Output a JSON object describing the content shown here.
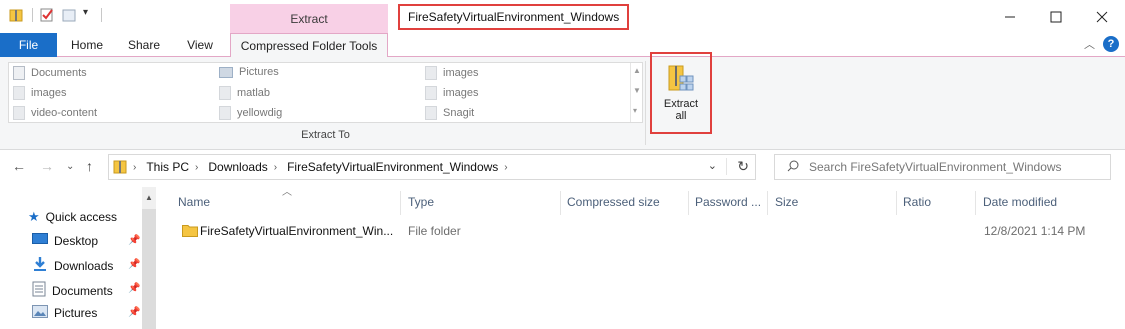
{
  "window": {
    "title": "FireSafetyVirtualEnvironment_Windows",
    "context_header": "Extract"
  },
  "tabs": {
    "file": "File",
    "home": "Home",
    "share": "Share",
    "view": "View",
    "compressed": "Compressed Folder Tools"
  },
  "ribbon": {
    "gallery": [
      {
        "label": "Documents",
        "icon": "documents-icon"
      },
      {
        "label": "images",
        "icon": "folder-icon"
      },
      {
        "label": "video-content",
        "icon": "folder-icon"
      },
      {
        "label": "Pictures",
        "icon": "pictures-icon"
      },
      {
        "label": "matlab",
        "icon": "folder-icon"
      },
      {
        "label": "yellowdig",
        "icon": "folder-icon"
      },
      {
        "label": "images",
        "icon": "folder-icon"
      },
      {
        "label": "images",
        "icon": "folder-icon"
      },
      {
        "label": "Snagit",
        "icon": "folder-icon"
      }
    ],
    "group_label": "Extract To",
    "extract_all": {
      "line1": "Extract",
      "line2": "all"
    }
  },
  "address": {
    "crumbs": [
      "This PC",
      "Downloads",
      "FireSafetyVirtualEnvironment_Windows"
    ],
    "search_placeholder": "Search FireSafetyVirtualEnvironment_Windows"
  },
  "nav_pane": {
    "items": [
      {
        "label": "Quick access",
        "icon": "star-icon",
        "pinned": false
      },
      {
        "label": "Desktop",
        "icon": "desktop-icon",
        "pinned": true
      },
      {
        "label": "Downloads",
        "icon": "download-icon",
        "pinned": true
      },
      {
        "label": "Documents",
        "icon": "documents-icon",
        "pinned": true
      },
      {
        "label": "Pictures",
        "icon": "pictures-icon",
        "pinned": true
      }
    ]
  },
  "columns": [
    "Name",
    "Type",
    "Compressed size",
    "Password ...",
    "Size",
    "Ratio",
    "Date modified"
  ],
  "rows": [
    {
      "name": "FireSafetyVirtualEnvironment_Win...",
      "type": "File folder",
      "date": "12/8/2021 1:14 PM"
    }
  ],
  "colors": {
    "accent": "#1a6ec8",
    "context_tab": "#f8d0e6",
    "highlight_border": "#e0403d",
    "folder_yellow": "#f5c542"
  }
}
